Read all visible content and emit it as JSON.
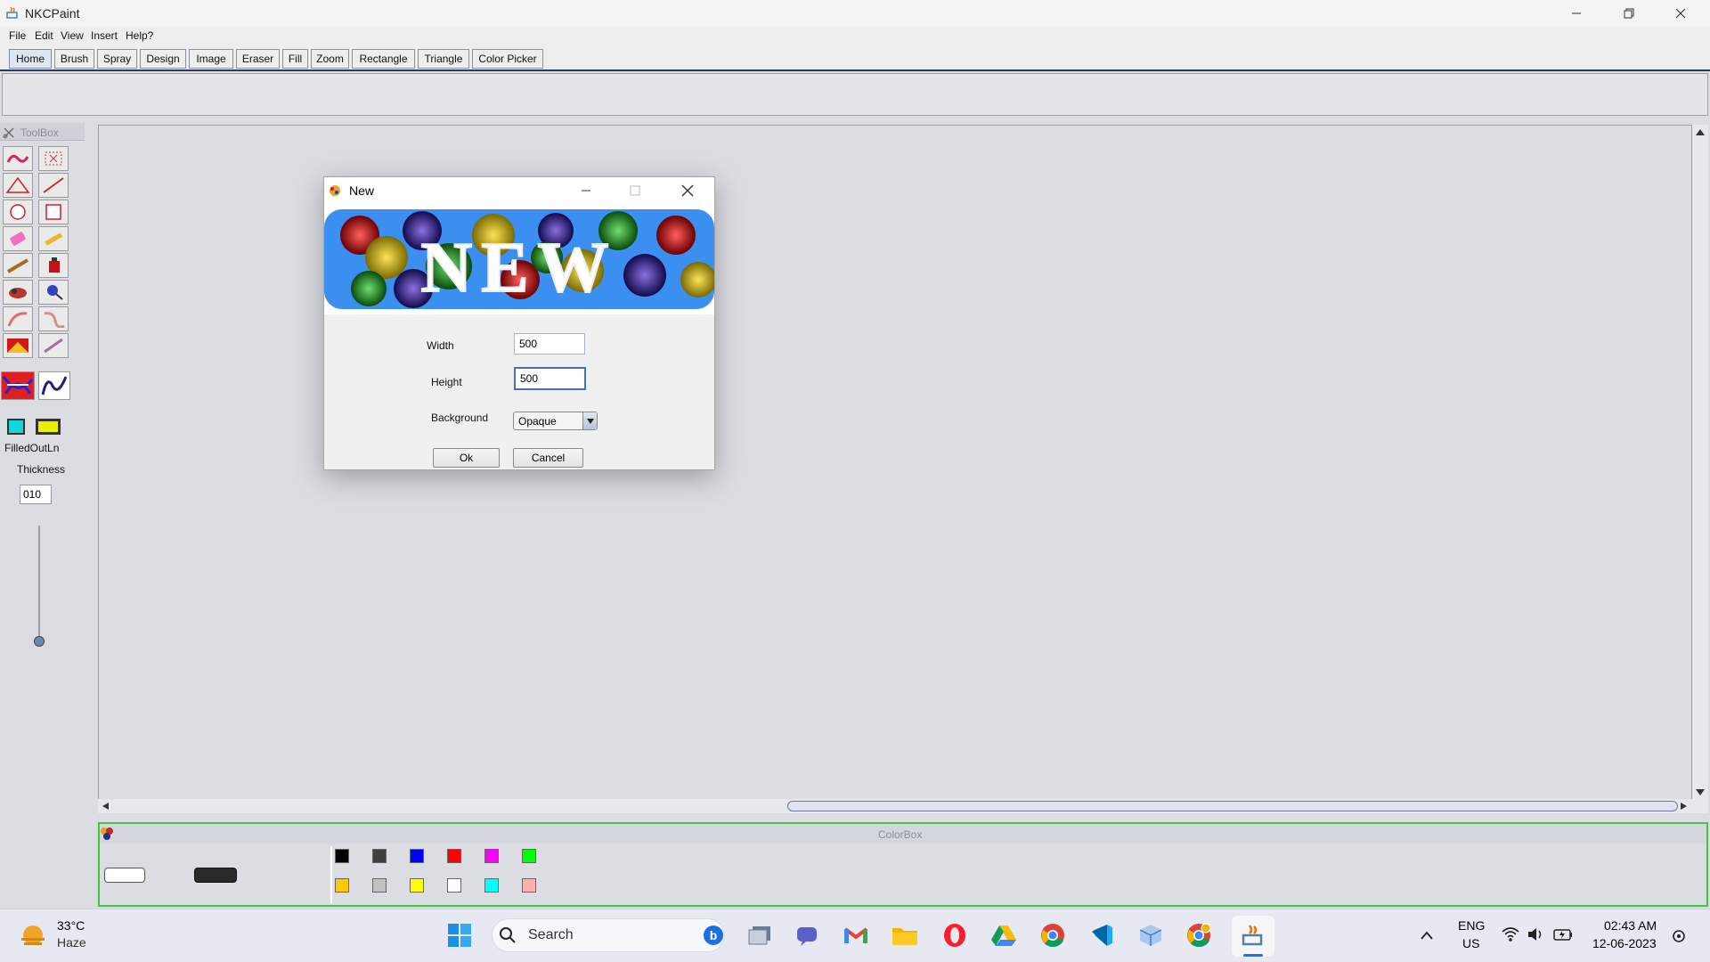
{
  "window": {
    "title": "NKCPaint"
  },
  "menu": [
    "File",
    "Edit",
    "View",
    "Insert",
    "Help?"
  ],
  "tabs": [
    "Home",
    "Brush",
    "Spray",
    "Design",
    "Image",
    "Eraser",
    "Fill",
    "Zoom",
    "Rectangle",
    "Triangle",
    "Color Picker"
  ],
  "toolbox": {
    "title": "ToolBox",
    "fill_label": "FilledOutLn",
    "thickness_label": "Thickness",
    "thickness_value": "010"
  },
  "colorbox": {
    "title": "ColorBox",
    "colors_row1": [
      "#000000",
      "#404040",
      "#0000ff",
      "#ff0000",
      "#ff00ff",
      "#00ff00"
    ],
    "colors_row2": [
      "#ffc800",
      "#c0c0c0",
      "#ffff00",
      "#ffffff",
      "#00ffff",
      "#ffafaf"
    ]
  },
  "dialog": {
    "title": "New",
    "banner_text": "NEW",
    "width_label": "Width",
    "width_value": "500",
    "height_label": "Height",
    "height_value": "500",
    "background_label": "Background",
    "background_value": "Opaque",
    "ok_label": "Ok",
    "cancel_label": "Cancel"
  },
  "taskbar": {
    "weather_temp": "33°C",
    "weather_desc": "Haze",
    "search_label": "Search",
    "lang_top": "ENG",
    "lang_bottom": "US",
    "time": "02:43 AM",
    "date": "12-06-2023"
  }
}
